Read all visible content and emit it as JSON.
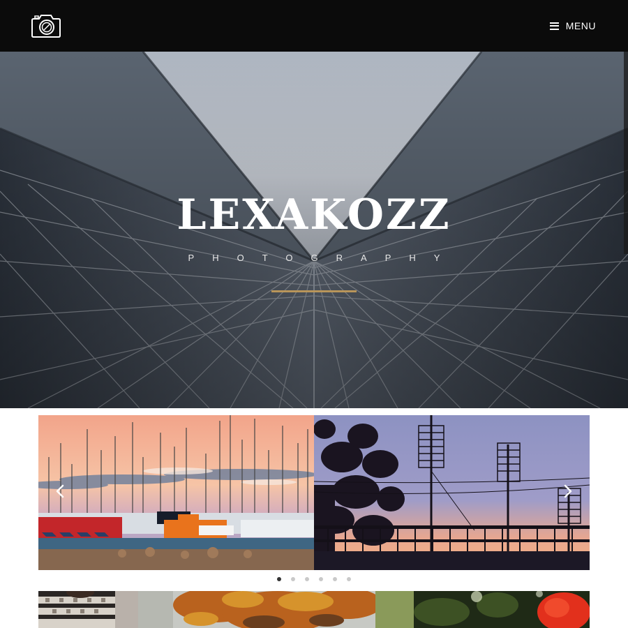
{
  "header": {
    "logo_name": "camera-logo",
    "menu_label": "MENU"
  },
  "hero": {
    "title": "LEXAKOZZ",
    "subtitle": "PHOTOGRAPHY"
  },
  "carousel": {
    "slides": [
      {
        "name": "harbor-sailboats-sunset"
      },
      {
        "name": "antennas-silhouette-sunset"
      }
    ],
    "dots_count": 6,
    "active_dot": 1,
    "prev_icon": "chevron-left-icon",
    "next_icon": "chevron-right-icon"
  },
  "gallery": {
    "thumbs": [
      {
        "name": "person-knit-sweater"
      },
      {
        "name": "autumn-tree"
      },
      {
        "name": "red-flower"
      }
    ]
  },
  "colors": {
    "topbar": "#0b0b0b",
    "accent_divider": "#b8955a",
    "dot_active": "#333333",
    "dot_inactive": "#c9c9c9"
  }
}
